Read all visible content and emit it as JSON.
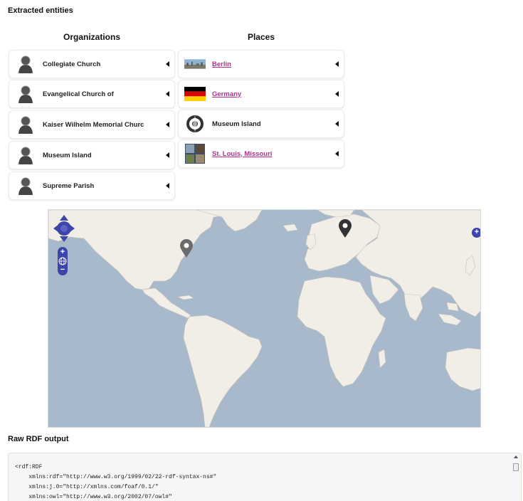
{
  "extracted_title": "Extracted entities",
  "organizations": {
    "heading": "Organizations",
    "items": [
      {
        "label": "Collegiate Church"
      },
      {
        "label": "Evangelical Church of"
      },
      {
        "label": "Kaiser Wilhelm Memorial Churc"
      },
      {
        "label": "Museum Island"
      },
      {
        "label": "Supreme Parish"
      }
    ]
  },
  "places": {
    "heading": "Places",
    "items": [
      {
        "label": "Berlin",
        "link": true
      },
      {
        "label": "Germany",
        "link": true
      },
      {
        "label": "Museum Island",
        "link": false
      },
      {
        "label": "St. Louis, Missouri",
        "link": true
      }
    ]
  },
  "map": {
    "zoom_in": "+",
    "zoom_out": "−",
    "layers": "+",
    "colors": {
      "ocean": "#a8b9cb",
      "land": "#f1eee8",
      "marker_dark": "#333333",
      "marker_gray": "#6b6b6b",
      "control": "#3d46a8"
    }
  },
  "rdf_title": "Raw RDF output",
  "rdf_lines": [
    "<rdf:RDF",
    "    xmlns:rdf=\"http://www.w3.org/1999/02/22-rdf-syntax-ns#\"",
    "    xmlns:j.0=\"http://xmlns.com/foaf/0.1/\"",
    "    xmlns:owl=\"http://www.w3.org/2002/07/owl#\""
  ]
}
